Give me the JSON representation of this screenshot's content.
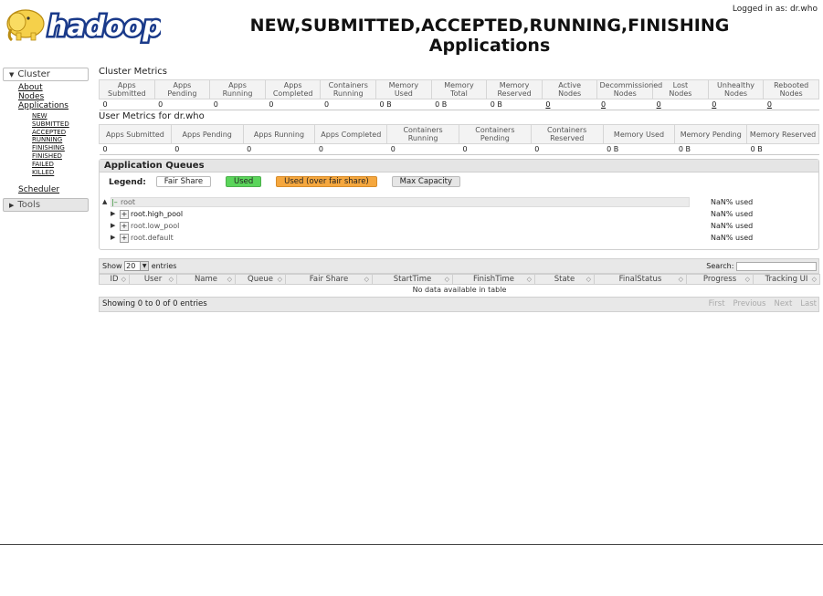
{
  "header": {
    "logo_text": "hadoop",
    "title_line1": "NEW,SUBMITTED,ACCEPTED,RUNNING,FINISHING",
    "title_line2": "Applications",
    "logged_in": "Logged in as: dr.who"
  },
  "nav": {
    "cluster_label": "Cluster",
    "items": [
      "About",
      "Nodes",
      "Applications"
    ],
    "app_states": [
      "NEW",
      "SUBMITTED",
      "ACCEPTED",
      "RUNNING",
      "FINISHING",
      "FINISHED",
      "FAILED",
      "KILLED"
    ],
    "scheduler": "Scheduler",
    "tools_label": "Tools"
  },
  "cluster_metrics": {
    "title": "Cluster Metrics",
    "headers": [
      [
        "Apps",
        "Submitted"
      ],
      [
        "Apps",
        "Pending"
      ],
      [
        "Apps",
        "Running"
      ],
      [
        "Apps",
        "Completed"
      ],
      [
        "Containers",
        "Running"
      ],
      [
        "Memory",
        "Used"
      ],
      [
        "Memory",
        "Total"
      ],
      [
        "Memory",
        "Reserved"
      ],
      [
        "Active",
        "Nodes"
      ],
      [
        "Decommissioned",
        "Nodes"
      ],
      [
        "Lost",
        "Nodes"
      ],
      [
        "Unhealthy",
        "Nodes"
      ],
      [
        "Rebooted",
        "Nodes"
      ]
    ],
    "values": [
      "0",
      "0",
      "0",
      "0",
      "0",
      "0 B",
      "0 B",
      "0 B",
      "0",
      "0",
      "0",
      "0",
      "0"
    ]
  },
  "user_metrics": {
    "title": "User Metrics for dr.who",
    "headers": [
      "Apps Submitted",
      "Apps Pending",
      "Apps Running",
      "Apps Completed",
      "Containers Running",
      "Containers Pending",
      "Containers Reserved",
      "Memory Used",
      "Memory Pending",
      "Memory Reserved"
    ],
    "values": [
      "0",
      "0",
      "0",
      "0",
      "0",
      "0",
      "0",
      "0 B",
      "0 B",
      "0 B"
    ]
  },
  "queues": {
    "title": "Application Queues",
    "legend_label": "Legend:",
    "legend": [
      {
        "label": "Fair Share",
        "bg": "#ffffff",
        "border": "#bbbbbb"
      },
      {
        "label": "Used",
        "bg": "#5bd55b",
        "border": "#4cb04c"
      },
      {
        "label": "Used (over fair share)",
        "bg": "#f5a73e",
        "border": "#d88c2a"
      },
      {
        "label": "Max Capacity",
        "bg": "#e6e6e6",
        "border": "#bbbbbb"
      }
    ],
    "tree": [
      {
        "name": "root",
        "used": "NaN% used"
      },
      {
        "name": "root.high_pool",
        "used": "NaN% used"
      },
      {
        "name": "root.low_pool",
        "used": "NaN% used"
      },
      {
        "name": "root.default",
        "used": "NaN% used"
      }
    ]
  },
  "apps_table": {
    "show_label": "Show",
    "page_size": "20",
    "entries_label": "entries",
    "search_label": "Search:",
    "search_value": "",
    "columns": [
      "ID",
      "User",
      "Name",
      "Queue",
      "Fair Share",
      "StartTime",
      "FinishTime",
      "State",
      "FinalStatus",
      "Progress",
      "Tracking UI"
    ],
    "empty_message": "No data available in table",
    "info": "Showing 0 to 0 of 0 entries",
    "pager": [
      "First",
      "Previous",
      "Next",
      "Last"
    ]
  }
}
